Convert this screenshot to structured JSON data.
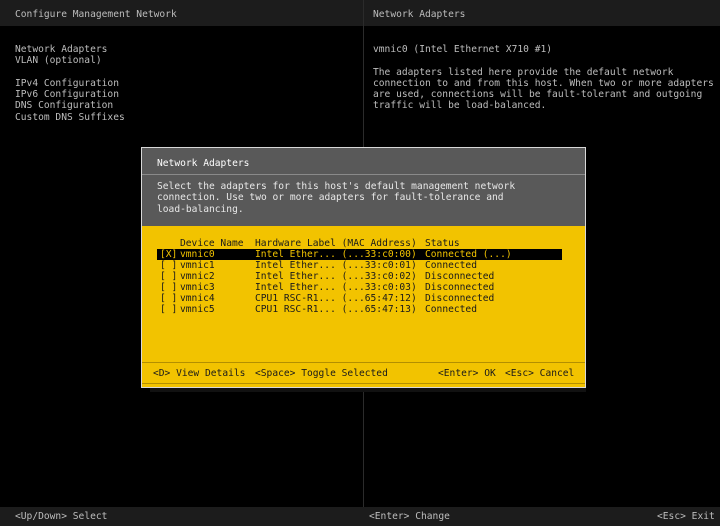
{
  "left_panel": {
    "title": "Configure Management Network",
    "menu": [
      "Network Adapters",
      "VLAN (optional)",
      "IPv4 Configuration",
      "IPv6 Configuration",
      "DNS Configuration",
      "Custom DNS Suffixes"
    ]
  },
  "right_panel": {
    "title": "Network Adapters",
    "adapter_line": "vmnic0 (Intel Ethernet X710 #1)",
    "description": [
      "The adapters listed here provide the default network",
      "connection to and from this host. When two or more adapters",
      "are used, connections will be fault-tolerant and outgoing",
      "traffic will be load-balanced."
    ]
  },
  "dialog": {
    "title": "Network Adapters",
    "description": [
      "Select the adapters for this host's default management network",
      "connection. Use two or more adapters for fault-tolerance and",
      "load-balancing."
    ],
    "columns": {
      "device": "Device Name",
      "hardware": "Hardware Label (MAC Address)",
      "status": "Status"
    },
    "rows": [
      {
        "check": "[X]",
        "device": "vmnic0",
        "hardware": "Intel Ether... (...33:c0:00)",
        "status": "Connected (...)",
        "selected": true
      },
      {
        "check": "[ ]",
        "device": "vmnic1",
        "hardware": "Intel Ether... (...33:c0:01)",
        "status": "Connected",
        "selected": false
      },
      {
        "check": "[ ]",
        "device": "vmnic2",
        "hardware": "Intel Ether... (...33:c0:02)",
        "status": "Disconnected",
        "selected": false
      },
      {
        "check": "[ ]",
        "device": "vmnic3",
        "hardware": "Intel Ether... (...33:c0:03)",
        "status": "Disconnected",
        "selected": false
      },
      {
        "check": "[ ]",
        "device": "vmnic4",
        "hardware": "CPU1 RSC-R1... (...65:47:12)",
        "status": "Disconnected",
        "selected": false
      },
      {
        "check": "[ ]",
        "device": "vmnic5",
        "hardware": "CPU1 RSC-R1... (...65:47:13)",
        "status": "Connected",
        "selected": false
      }
    ],
    "actions": {
      "view_key": "<D>",
      "view_label": "View Details",
      "toggle_key": "<Space>",
      "toggle_label": "Toggle Selected",
      "ok_key": "<Enter>",
      "ok_label": "OK",
      "cancel_key": "<Esc>",
      "cancel_label": "Cancel"
    }
  },
  "footer": {
    "select_key": "<Up/Down>",
    "select_label": "Select",
    "change_key": "<Enter>",
    "change_label": "Change",
    "exit_key": "<Esc>",
    "exit_label": "Exit"
  },
  "colors": {
    "background": "#000000",
    "header": "#1c1c1c",
    "dialog_gray": "#595959",
    "dialog_yellow": "#f2c300",
    "text_gray": "#bdbdbd"
  }
}
